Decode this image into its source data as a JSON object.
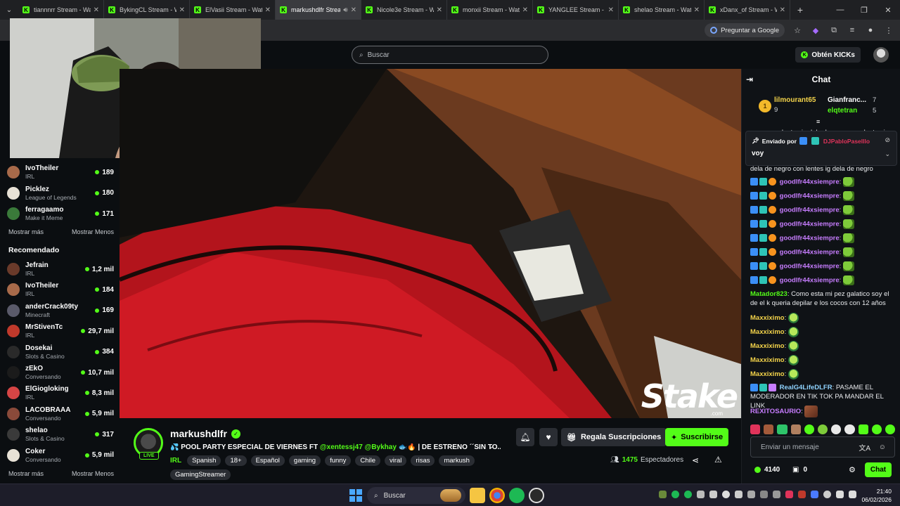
{
  "browser": {
    "tabs": [
      {
        "title": "tiannnrr Stream - Wa",
        "active": false
      },
      {
        "title": "BykingCL Stream - Wa",
        "active": false
      },
      {
        "title": "ElVasii Stream - Watc",
        "active": false
      },
      {
        "title": "markushdlfr Strea",
        "active": true
      },
      {
        "title": "Nicole3e Stream - W",
        "active": false
      },
      {
        "title": "monxii Stream - Watc",
        "active": false
      },
      {
        "title": "YANGLEE Stream - W",
        "active": false
      },
      {
        "title": "shelao Stream - Watc",
        "active": false
      },
      {
        "title": "xDanx_of Stream - W",
        "active": false
      }
    ],
    "ask_google": "Preguntar a Google"
  },
  "header": {
    "search_placeholder": "Buscar",
    "kicks_button": "Obtén KICKs"
  },
  "sidebar": {
    "following": [
      {
        "name": "IvoTheiler",
        "category": "IRL",
        "viewers": "189",
        "color": "#a86a4a"
      },
      {
        "name": "Picklez",
        "category": "League of Legends",
        "viewers": "180",
        "color": "#e8e2d6"
      },
      {
        "name": "ferragaamo",
        "category": "Make it Meme",
        "viewers": "171",
        "color": "#3a7a3a"
      }
    ],
    "show_more": "Mostrar más",
    "show_less": "Mostrar Menos",
    "recommended_heading": "Recomendado",
    "recommended": [
      {
        "name": "Jefrain",
        "category": "IRL",
        "viewers": "1,2 mil",
        "color": "#6a3a2a"
      },
      {
        "name": "IvoTheiler",
        "category": "IRL",
        "viewers": "184",
        "color": "#a86a4a"
      },
      {
        "name": "anderCrack09ty",
        "category": "Minecraft",
        "viewers": "169",
        "color": "#5a5a6a"
      },
      {
        "name": "MrStivenTc",
        "category": "IRL",
        "viewers": "29,7 mil",
        "color": "#c0392b"
      },
      {
        "name": "Dosekai",
        "category": "Slots & Casino",
        "viewers": "384",
        "color": "#2a2a2a"
      },
      {
        "name": "zEkO",
        "category": "Conversando",
        "viewers": "10,7 mil",
        "color": "#1b1b1b"
      },
      {
        "name": "ElGiogloking",
        "category": "IRL",
        "viewers": "8,3 mil",
        "color": "#d64545"
      },
      {
        "name": "LACOBRAAA",
        "category": "Conversando",
        "viewers": "5,9 mil",
        "color": "#8a4a3a"
      },
      {
        "name": "shelao",
        "category": "Slots & Casino",
        "viewers": "317",
        "color": "#3a3a3a"
      },
      {
        "name": "Coker",
        "category": "Conversando",
        "viewers": "5,9 mil",
        "color": "#e8e2d6"
      }
    ],
    "show_more_2": "Mostrar más",
    "show_less_2": "Mostrar Menos"
  },
  "video": {
    "watermark": "Stake",
    "watermark_sub": ".com"
  },
  "stream": {
    "streamer": "markushdlfr",
    "live": "LIVE",
    "title_prefix": "💦 POOL PARTY ESPECIAL DE VIERNES FT ",
    "mention1": "@xentessj47",
    "mention2": "@Bykhay",
    "title_suffix": " 🐟🔥 | DE ESTRENO ´´SIN TO...",
    "category": "IRL",
    "tags": [
      "Spanish",
      "18+",
      "Español",
      "gaming",
      "funny",
      "Chile",
      "viral",
      "risas",
      "markush"
    ],
    "tags2": [
      "GamingStreamer"
    ],
    "gift_button": "Regala Suscripciones",
    "subscribe_button": "Suscribirse",
    "viewer_count": "1475",
    "viewer_label": "Espectadores"
  },
  "chat": {
    "title": "Chat",
    "leaderboard": [
      {
        "rank": "1",
        "name": "lilmourant65",
        "value": "9",
        "color": "#f3d34a"
      },
      {
        "name": "Gianfranc...",
        "value": "7",
        "color": "#ffffff"
      },
      {
        "name": "elqtetran",
        "value": "5",
        "color": "#53fc18"
      }
    ],
    "top_text": "negro con lentes ig dela de negro con lentes ig",
    "pinned_by_label": "Enviado por",
    "pinned_user": "DJPabloPaselllo",
    "pinned_text": "voy",
    "after_pinned": "dela de negro con lentes ig dela de negro",
    "messages": [
      {
        "user": "goodlfr44xsiempre",
        "color": "#c77dff",
        "text": ""
      },
      {
        "user": "goodlfr44xsiempre",
        "color": "#c77dff",
        "text": ""
      },
      {
        "user": "goodlfr44xsiempre",
        "color": "#c77dff",
        "text": ""
      },
      {
        "user": "goodlfr44xsiempre",
        "color": "#c77dff",
        "text": ""
      },
      {
        "user": "goodlfr44xsiempre",
        "color": "#c77dff",
        "text": ""
      },
      {
        "user": "goodlfr44xsiempre",
        "color": "#c77dff",
        "text": ""
      },
      {
        "user": "goodlfr44xsiempre",
        "color": "#c77dff",
        "text": ""
      },
      {
        "user": "goodlfr44xsiempre",
        "color": "#c77dff",
        "text": ""
      }
    ],
    "matador": {
      "user": "Matador823",
      "text": "Como esta mi pez galatico soy el de el k queria depilar e los cocos con 12 años",
      "color": "#53fc18"
    },
    "maxx": {
      "user": "Maxxiximo",
      "color": "#f3d34a",
      "count": 5
    },
    "real": {
      "user": "RealG4LifeDLFR",
      "text": "PASAME EL MODERADOR EN TIK TOK PA MANDAR EL LINK",
      "color": "#8fd3ff"
    },
    "rexi": {
      "user": "REXITOSAURIO",
      "color": "#c77dff"
    },
    "input_placeholder": "Enviar un mensaje",
    "kicks_balance": "4140",
    "boxes": "0",
    "send_button": "Chat"
  },
  "taskbar": {
    "search": "Buscar",
    "time": "21:40",
    "date": "06/02/2026"
  }
}
